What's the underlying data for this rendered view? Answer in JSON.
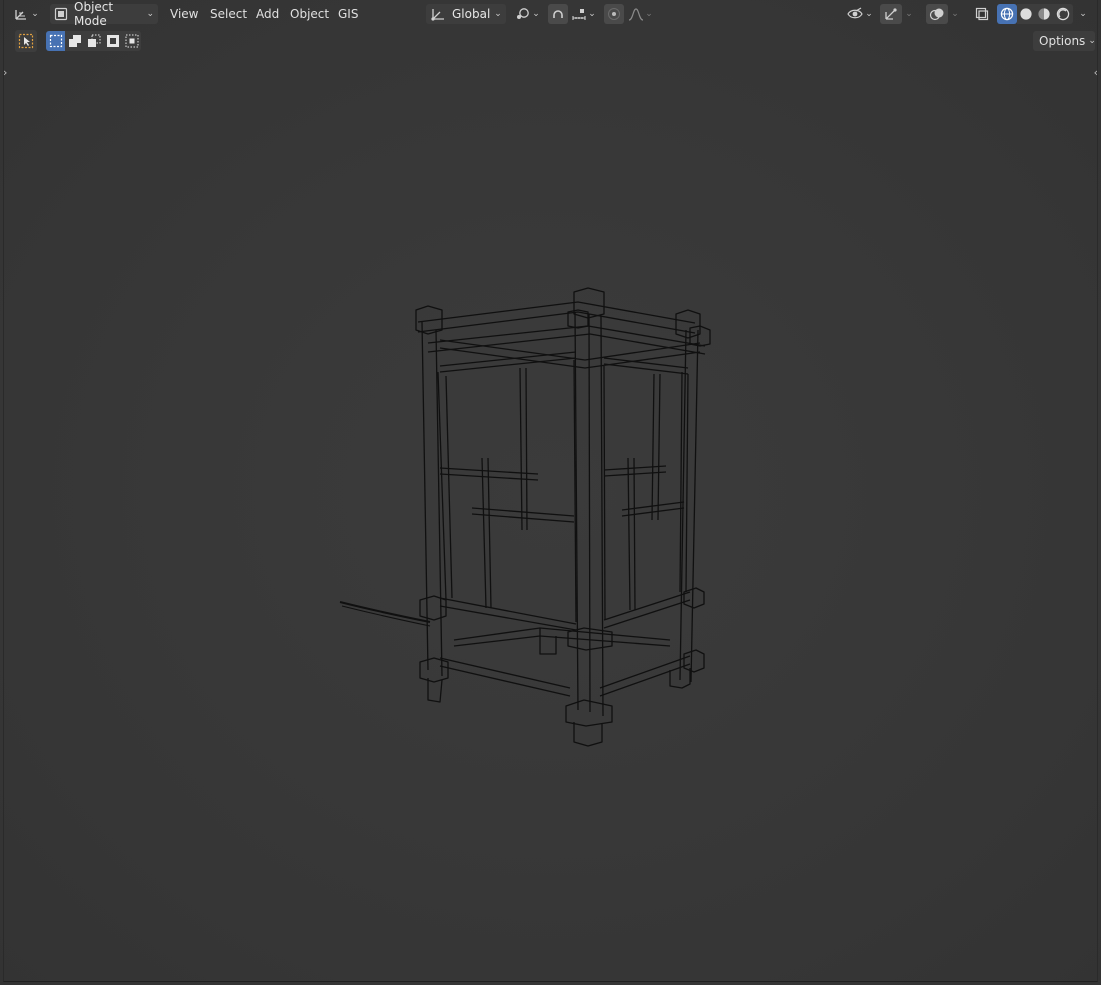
{
  "header": {
    "mode_label": "Object Mode",
    "menus": [
      "View",
      "Select",
      "Add",
      "Object",
      "GIS"
    ],
    "transform_orientation": "Global"
  },
  "tool_header": {
    "options_label": "Options"
  },
  "icons": {
    "editor_type": "viewport-editor-icon",
    "mode": "object-mode-icon",
    "orientation": "transform-orientation-icon",
    "pivot": "pivot-point-icon",
    "snap": "snap-magnet-icon",
    "snap_target": "snap-increment-icon",
    "proportional": "proportional-editing-icon",
    "falloff": "falloff-curve-icon",
    "visibility": "eye-icon",
    "gizmo": "gizmo-icon",
    "overlay": "overlay-icon",
    "xray": "xray-icon",
    "shading": [
      "wireframe-shading-icon",
      "solid-shading-icon",
      "material-shading-icon",
      "rendered-shading-icon"
    ]
  },
  "colors": {
    "accent": "#4772b3",
    "viewport_bg": "#393939",
    "wire": "#0e0e0e"
  }
}
